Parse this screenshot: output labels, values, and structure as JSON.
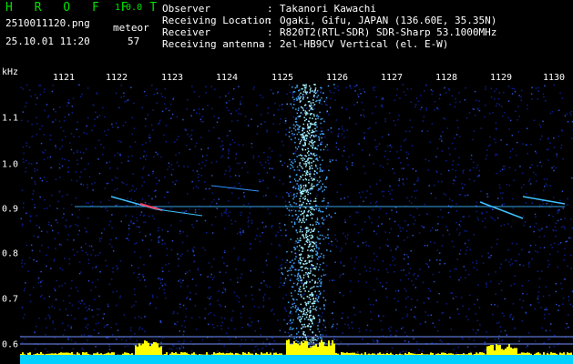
{
  "header": {
    "app_title": "H R O F F T",
    "app_version": "1.0.0",
    "file_name": "2510011120.png",
    "timestamp": "25.10.01 11:20",
    "meteor_label": "meteor",
    "meteor_count": "57"
  },
  "info": [
    {
      "key": "Observer",
      "sep": ":",
      "value": "Takanori Kawachi"
    },
    {
      "key": "Receiving Location",
      "sep": ":",
      "value": "Ogaki, Gifu, JAPAN (136.60E, 35.35N)"
    },
    {
      "key": "Receiver",
      "sep": ":",
      "value": "R820T2(RTL-SDR) SDR-Sharp 53.1000MHz"
    },
    {
      "key": "Receiving antenna",
      "sep": ":",
      "value": "2el-HB9CV Vertical (el. E-W)"
    }
  ],
  "axes": {
    "y_unit": "kHz",
    "y_ticks": [
      "1.1",
      "1.0",
      "0.9",
      "0.8",
      "0.7",
      "0.6"
    ],
    "x_ticks": [
      "1121",
      "1122",
      "1123",
      "1124",
      "1125",
      "1126",
      "1127",
      "1128",
      "1129",
      "1130"
    ]
  },
  "colors": {
    "background": "#000000",
    "noise": "#0a1e8c",
    "carrier": "#3cb4ff",
    "echo_hot": "#ff4060",
    "baseline": "#00d0ff",
    "activity": "#ffff00"
  }
}
